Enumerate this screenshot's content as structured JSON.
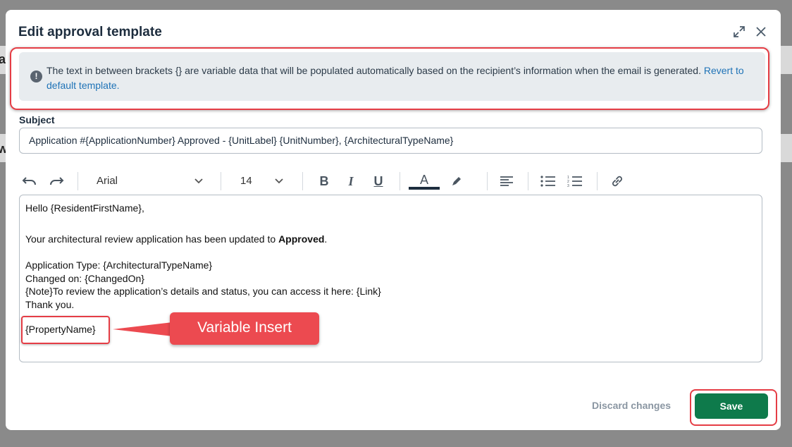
{
  "background": {
    "frag_letter_1": "a",
    "frag_letter_2": "w"
  },
  "modal": {
    "title": "Edit approval template",
    "icons": [
      "expand-icon",
      "close-icon"
    ]
  },
  "info": {
    "text": "The text in between brackets {} are variable data that will be populated automatically based on the recipient’s information when the email is generated.",
    "link": "Revert to default template."
  },
  "subject": {
    "label": "Subject",
    "value": "Application #{ApplicationNumber} Approved - {UnitLabel} {UnitNumber}, {ArchitecturalTypeName}"
  },
  "toolbar": {
    "font": "Arial",
    "size": "14",
    "text_color": "#1d2d3e"
  },
  "editor": {
    "greeting": "Hello {ResidentFirstName},",
    "updated_prefix": "Your architectural review application has been updated to ",
    "updated_bold": "Approved",
    "updated_suffix": ".",
    "type_line": "Application Type: {ArchitecturalTypeName}",
    "changed_line": "Changed on: {ChangedOn}",
    "note_line": "{Note}To review the application’s details and status, you can access it here: {Link}",
    "thanks": "Thank you.",
    "property": "{PropertyName}"
  },
  "annotation": {
    "callout": "Variable Insert",
    "highlight_color": "#e53d45"
  },
  "footer": {
    "discard": "Discard changes",
    "save": "Save"
  }
}
